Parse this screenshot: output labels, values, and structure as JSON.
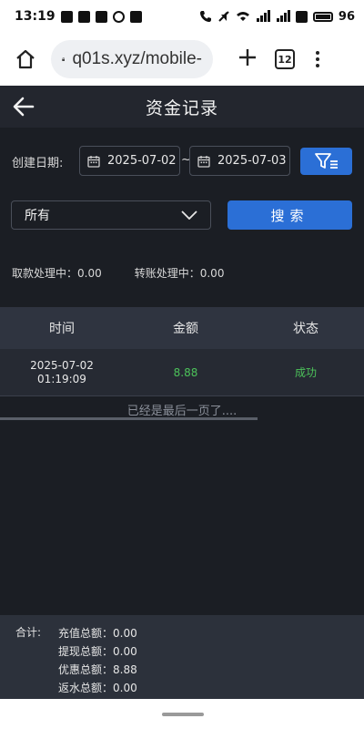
{
  "status_bar": {
    "time": "13:19",
    "battery": "96"
  },
  "browser": {
    "url": "q01s.xyz/mobile-",
    "tab_count": "12"
  },
  "header": {
    "title": "资金记录"
  },
  "filter": {
    "date_label": "创建日期:",
    "start_date": "2025-07-02",
    "separator": "~",
    "end_date": "2025-07-03",
    "type_selected": "所有",
    "search_label": "搜索"
  },
  "processing": {
    "withdraw": "取款处理中：0.00",
    "transfer": "转账处理中：0.00"
  },
  "table": {
    "headers": [
      "时间",
      "金额",
      "状态"
    ],
    "rows": [
      {
        "date": "2025-07-02",
        "time": "01:19:09",
        "amount": "8.88",
        "status": "成功"
      }
    ],
    "end_message": "已经是最后一页了...."
  },
  "totals": {
    "label": "合计:",
    "lines": [
      "充值总额：0.00",
      "提现总额：0.00",
      "优惠总额：8.88",
      "返水总额：0.00"
    ]
  },
  "colors": {
    "accent": "#2b6fd6",
    "success": "#4cc25a"
  }
}
